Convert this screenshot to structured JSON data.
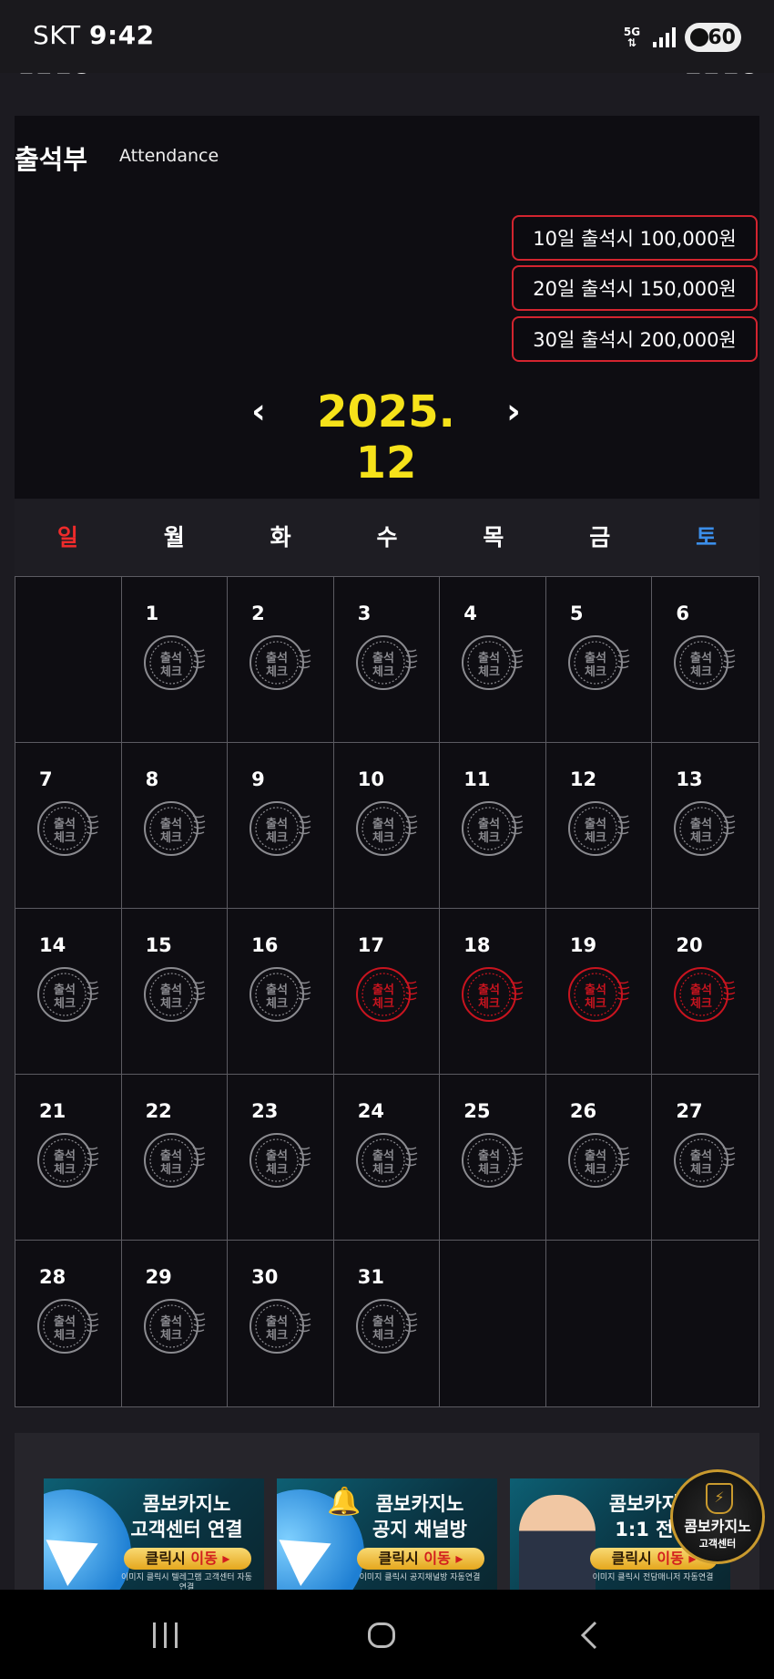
{
  "status_bar": {
    "carrier": "SKT",
    "time": "9:42",
    "network": "5G",
    "battery": "60"
  },
  "top_nav": {
    "left_label": "입금신청",
    "right_label": "출금신청"
  },
  "attendance": {
    "title": "출석부",
    "subtitle": "Attendance",
    "rewards": [
      "10일 출석시 100,000원",
      "20일 출석시 150,000원",
      "30일 출석시 200,000원"
    ],
    "month_label": "2025. 12",
    "prev_icon": "‹",
    "next_icon": "›",
    "weekdays": [
      "일",
      "월",
      "화",
      "수",
      "목",
      "금",
      "토"
    ],
    "stamp_text": [
      "출석",
      "체크"
    ],
    "stamp_color_inactive": "#8a8a8f",
    "stamp_color_active": "#c8141f",
    "days": [
      {
        "day": "",
        "checked": false
      },
      {
        "day": "1",
        "checked": false
      },
      {
        "day": "2",
        "checked": false
      },
      {
        "day": "3",
        "checked": false
      },
      {
        "day": "4",
        "checked": false
      },
      {
        "day": "5",
        "checked": false
      },
      {
        "day": "6",
        "checked": false
      },
      {
        "day": "7",
        "checked": false
      },
      {
        "day": "8",
        "checked": false
      },
      {
        "day": "9",
        "checked": false
      },
      {
        "day": "10",
        "checked": false
      },
      {
        "day": "11",
        "checked": false
      },
      {
        "day": "12",
        "checked": false
      },
      {
        "day": "13",
        "checked": false
      },
      {
        "day": "14",
        "checked": false
      },
      {
        "day": "15",
        "checked": false
      },
      {
        "day": "16",
        "checked": false
      },
      {
        "day": "17",
        "checked": true
      },
      {
        "day": "18",
        "checked": true
      },
      {
        "day": "19",
        "checked": true
      },
      {
        "day": "20",
        "checked": true
      },
      {
        "day": "21",
        "checked": false
      },
      {
        "day": "22",
        "checked": false
      },
      {
        "day": "23",
        "checked": false
      },
      {
        "day": "24",
        "checked": false
      },
      {
        "day": "25",
        "checked": false
      },
      {
        "day": "26",
        "checked": false
      },
      {
        "day": "27",
        "checked": false
      },
      {
        "day": "28",
        "checked": false
      },
      {
        "day": "29",
        "checked": false
      },
      {
        "day": "30",
        "checked": false
      },
      {
        "day": "31",
        "checked": false
      },
      {
        "day": "",
        "checked": false
      },
      {
        "day": "",
        "checked": false
      },
      {
        "day": "",
        "checked": false
      }
    ]
  },
  "banners": [
    {
      "title1": "콤보카지노",
      "title2": "고객센터 연결",
      "button_main": "클릭시 ",
      "button_hl": "이동 ▸",
      "small": "이미지 클릭시\n텔레그램 고객센터 자동연결",
      "icon": "telegram-plane-icon"
    },
    {
      "title1": "콤보카지노",
      "title2": "공지 채널방",
      "button_main": "클릭시 ",
      "button_hl": "이동 ▸",
      "small": "이미지 클릭시\n공지채널방 자동연결",
      "icon": "bell-icon"
    },
    {
      "title1": "콤보카지노",
      "title2": "1:1 전담",
      "button_main": "클릭시 ",
      "button_hl": "이동 ▸",
      "small": "이미지 클릭시\n전담매니저 자동연결",
      "icon": "manager-avatar-icon"
    }
  ],
  "floating_button": {
    "line1": "콤보카지노",
    "line2": "고객센터",
    "icon": "shield-icon"
  },
  "colors": {
    "accent_yellow": "#f6e21a",
    "reward_border": "#d3242f",
    "sunday": "#ef2b2b",
    "saturday": "#3b8ee9"
  }
}
